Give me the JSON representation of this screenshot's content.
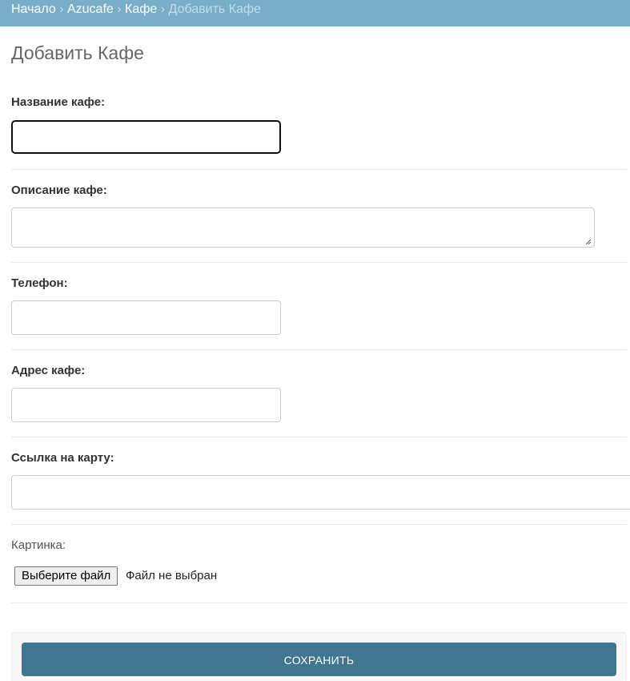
{
  "breadcrumbs": {
    "items": [
      "Начало",
      "Azucafe",
      "Кафе"
    ],
    "separator": "›",
    "current": "Добавить Кафе"
  },
  "page": {
    "title": "Добавить Кафе"
  },
  "form": {
    "fields": {
      "name": {
        "label": "Название кафе:",
        "value": ""
      },
      "description": {
        "label": "Описание кафе:",
        "value": ""
      },
      "phone": {
        "label": "Телефон:",
        "value": ""
      },
      "address": {
        "label": "Адрес кафе:",
        "value": ""
      },
      "map_link": {
        "label": "Ссылка на карту:",
        "value": ""
      },
      "image": {
        "label": "Картинка:",
        "button_label": "Выберите файл",
        "status": "Файл не выбран"
      }
    },
    "save_label": "СОХРАНИТЬ"
  },
  "colors": {
    "breadcrumbs_bg": "#79aec8",
    "save_button_bg": "#417690",
    "text": "#333333"
  },
  "icons": {
    "breadcrumb_separator": "chevron-right",
    "textarea_grip": "resize-grip-icon"
  }
}
